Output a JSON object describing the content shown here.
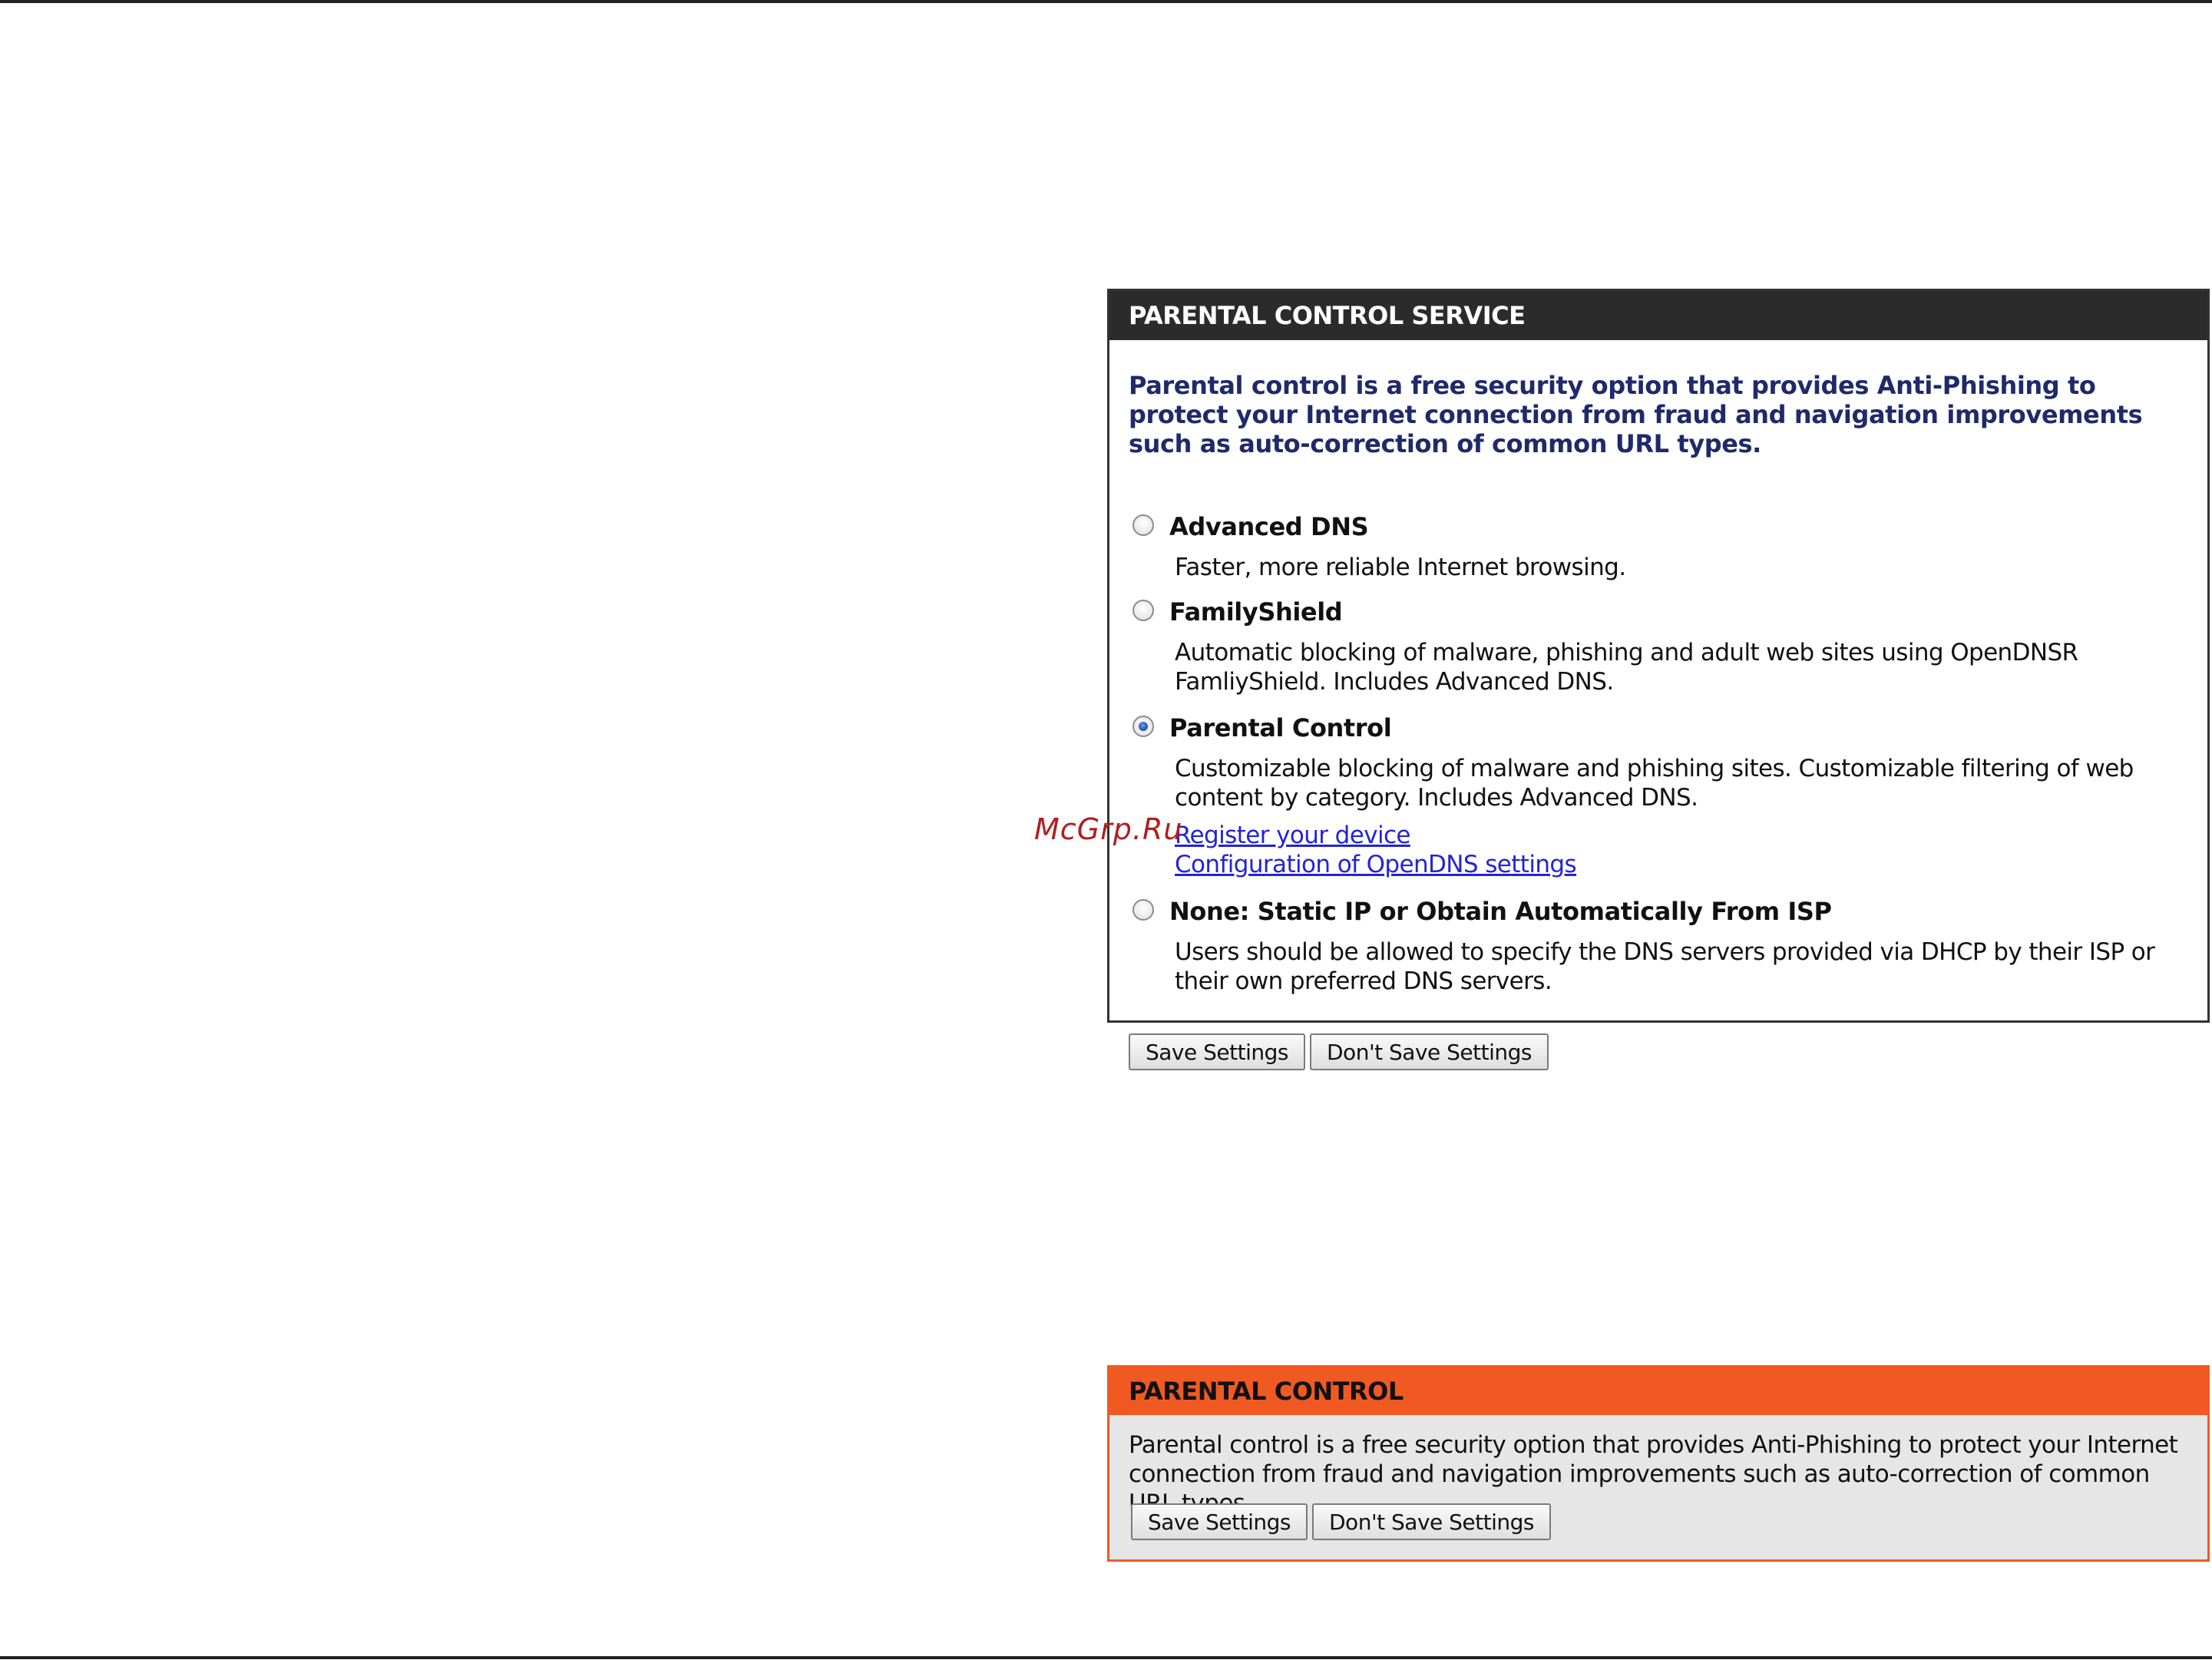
{
  "parental_control_service": {
    "header": "PARENTAL CONTROL SERVICE",
    "intro": "Parental control is a free security option that provides Anti-Phishing to protect your Internet connection from fraud and navigation improvements such as auto-correction of common URL types.",
    "options": [
      {
        "title": "Advanced DNS",
        "description": "Faster, more reliable Internet browsing.",
        "checked": false
      },
      {
        "title": "FamilyShield",
        "description": "Automatic blocking of malware, phishing and adult web sites using OpenDNSR FamliyShield. Includes Advanced DNS.",
        "checked": false
      },
      {
        "title": "Parental Control",
        "description": "Customizable blocking of malware and phishing sites. Customizable filtering of web content by category. Includes Advanced DNS.",
        "checked": true,
        "links": [
          "Register your device",
          "Configuration of OpenDNS settings"
        ]
      },
      {
        "title": "None: Static IP or Obtain Automatically From ISP",
        "description": "Users should be allowed to specify the DNS servers provided via DHCP by their ISP or their own preferred DNS servers.",
        "checked": false
      }
    ],
    "save_label": "Save Settings",
    "dont_save_label": "Don't Save Settings"
  },
  "watermark": "McGrp.Ru",
  "parental_control": {
    "header": "PARENTAL CONTROL",
    "description": "Parental control is a free security option that provides Anti-Phishing to protect your Internet connection from fraud and navigation improvements such as auto-correction of common URL types.",
    "save_label": "Save Settings",
    "dont_save_label": "Don't Save Settings"
  },
  "colors": {
    "service_header_bg": "#2b2b2b",
    "intro_text": "#1f2a6a",
    "link": "#2323d8",
    "control_header_bg": "#f05a22",
    "control_body_bg": "#e6e6e6",
    "watermark": "#b21e1e"
  }
}
